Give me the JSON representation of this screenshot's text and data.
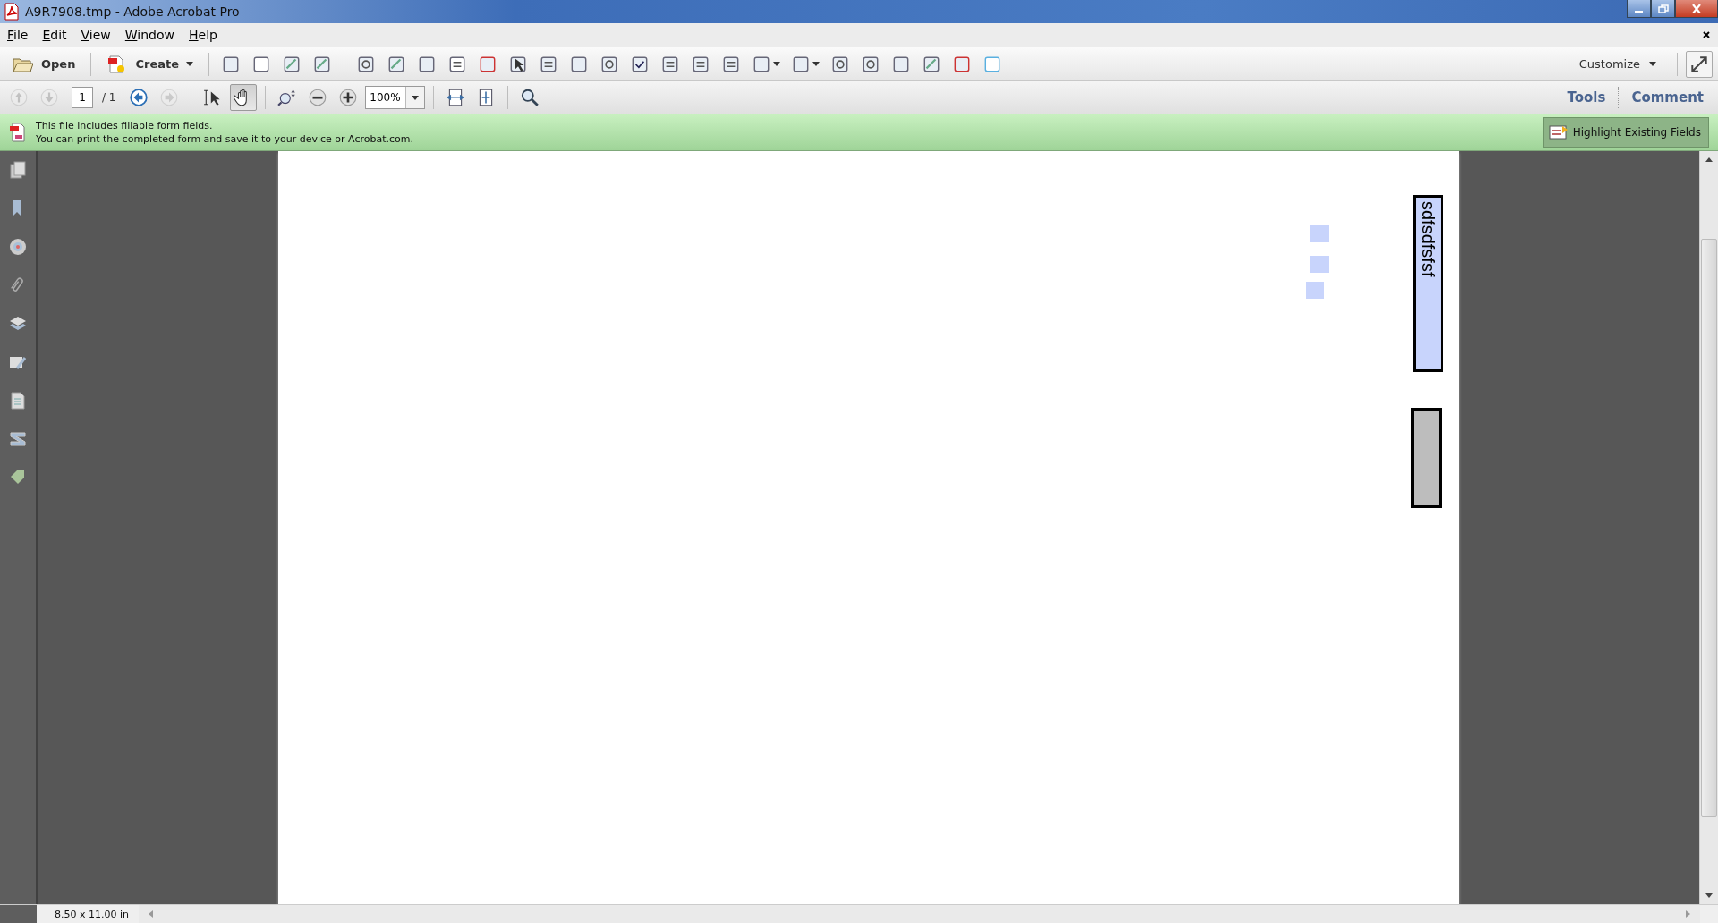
{
  "window": {
    "title": "A9R7908.tmp - Adobe Acrobat Pro"
  },
  "menu": [
    {
      "label": "File"
    },
    {
      "label": "Edit"
    },
    {
      "label": "View"
    },
    {
      "label": "Window"
    },
    {
      "label": "Help"
    }
  ],
  "toolbar": {
    "open": "Open",
    "create": "Create",
    "customize": "Customize"
  },
  "navigation": {
    "page": "1",
    "page_count": "/ 1",
    "zoom": "100%",
    "prev_disabled": true,
    "next_disabled": true,
    "back_disabled": false,
    "forward_disabled": true
  },
  "pointer_tools": [
    {
      "selected": false
    },
    {
      "selected": true
    }
  ],
  "panes": [
    {
      "label": "Tools"
    },
    {
      "label": "Comment"
    }
  ],
  "notice": {
    "lines": [
      "This file includes fillable form fields.",
      "You can print the completed form and save it to your device or Acrobat.com."
    ],
    "button": {
      "label": "Highlight Existing Fields",
      "pressed": true
    }
  },
  "form_fields": [
    {
      "kind": "checkbox",
      "checked": false
    },
    {
      "kind": "checkbox",
      "checked": false
    },
    {
      "kind": "checkbox",
      "checked": false
    },
    {
      "kind": "text",
      "value": "sdfsdfsfsf"
    },
    {
      "kind": "button"
    }
  ],
  "status_bar": {
    "page_size": "8.50 x 11.00 in"
  }
}
